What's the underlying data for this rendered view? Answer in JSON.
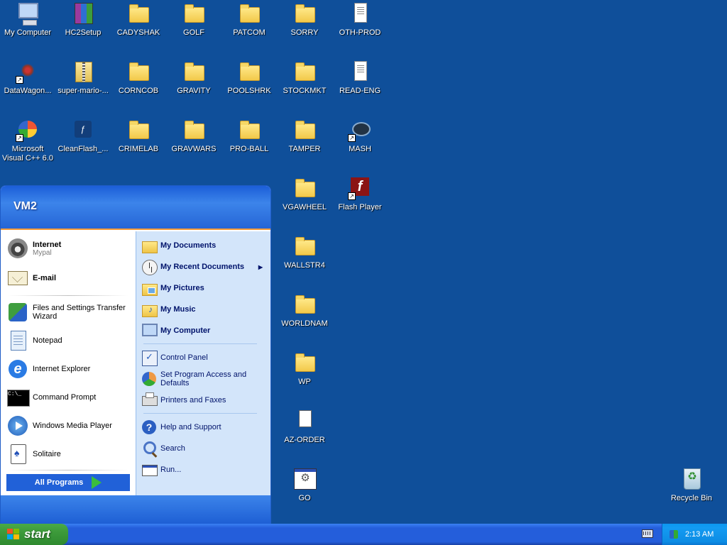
{
  "desktop": {
    "background_color": "#0F4F9A",
    "icons": [
      {
        "label": "My Computer",
        "icon": "my-computer-icon"
      },
      {
        "label": "HC2Setup",
        "icon": "winrar-archive-icon"
      },
      {
        "label": "CADYSHAK",
        "icon": "folder-icon"
      },
      {
        "label": "GOLF",
        "icon": "folder-icon"
      },
      {
        "label": "PATCOM",
        "icon": "folder-icon"
      },
      {
        "label": "SORRY",
        "icon": "folder-icon"
      },
      {
        "label": "OTH-PROD",
        "icon": "text-document-icon"
      },
      {
        "label": "DataWagon...",
        "icon": "datawagon-shortcut-icon"
      },
      {
        "label": "super-mario-...",
        "icon": "zip-archive-icon"
      },
      {
        "label": "CORNCOB",
        "icon": "folder-icon"
      },
      {
        "label": "GRAVITY",
        "icon": "folder-icon"
      },
      {
        "label": "POOLSHRK",
        "icon": "folder-icon"
      },
      {
        "label": "STOCKMKT",
        "icon": "folder-icon"
      },
      {
        "label": "READ-ENG",
        "icon": "text-document-icon"
      },
      {
        "label": "Microsoft Visual C++ 6.0",
        "icon": "visual-cpp-shortcut-icon"
      },
      {
        "label": "CleanFlash_...",
        "icon": "cleanflash-icon"
      },
      {
        "label": "CRIMELAB",
        "icon": "folder-icon"
      },
      {
        "label": "GRAVWARS",
        "icon": "folder-icon"
      },
      {
        "label": "PRO-BALL",
        "icon": "folder-icon"
      },
      {
        "label": "TAMPER",
        "icon": "folder-icon"
      },
      {
        "label": "MASH",
        "icon": "mash-shortcut-icon"
      },
      {
        "label": "VGAWHEEL",
        "icon": "folder-icon"
      },
      {
        "label": "Flash Player",
        "icon": "flash-player-shortcut-icon"
      },
      {
        "label": "WALLSTR4",
        "icon": "folder-icon"
      },
      {
        "label": "WORLDNAM",
        "icon": "folder-icon"
      },
      {
        "label": "WP",
        "icon": "folder-icon"
      },
      {
        "label": "AZ-ORDER",
        "icon": "blank-document-icon"
      },
      {
        "label": "GO",
        "icon": "batch-program-icon"
      },
      {
        "label": "Recycle Bin",
        "icon": "recycle-bin-icon"
      }
    ]
  },
  "start_menu": {
    "user_name": "VM2",
    "pinned": [
      {
        "title": "Internet",
        "subtitle": "Mypal",
        "icon": "mypal-browser-icon"
      },
      {
        "title": "E-mail",
        "subtitle": "",
        "icon": "email-icon"
      }
    ],
    "recent_programs": [
      {
        "label": "Files and Settings Transfer Wizard",
        "icon": "transfer-wizard-icon"
      },
      {
        "label": "Notepad",
        "icon": "notepad-icon"
      },
      {
        "label": "Internet Explorer",
        "icon": "internet-explorer-icon"
      },
      {
        "label": "Command Prompt",
        "icon": "command-prompt-icon"
      },
      {
        "label": "Windows Media Player",
        "icon": "media-player-icon"
      },
      {
        "label": "Solitaire",
        "icon": "solitaire-icon"
      }
    ],
    "all_programs_label": "All Programs",
    "places": [
      {
        "label": "My Documents",
        "icon": "my-documents-icon"
      },
      {
        "label": "My Recent Documents",
        "icon": "recent-documents-icon"
      },
      {
        "label": "My Pictures",
        "icon": "my-pictures-icon"
      },
      {
        "label": "My Music",
        "icon": "my-music-icon"
      },
      {
        "label": "My Computer",
        "icon": "my-computer-icon"
      }
    ],
    "settings": [
      {
        "label": "Control Panel",
        "icon": "control-panel-icon"
      },
      {
        "label": "Set Program Access and Defaults",
        "icon": "program-access-icon"
      },
      {
        "label": "Printers and Faxes",
        "icon": "printer-icon"
      }
    ],
    "tools": [
      {
        "label": "Help and Support",
        "icon": "help-icon"
      },
      {
        "label": "Search",
        "icon": "search-icon"
      },
      {
        "label": "Run...",
        "icon": "run-icon"
      }
    ]
  },
  "taskbar": {
    "start_label": "start",
    "clock": "2:13 AM"
  }
}
